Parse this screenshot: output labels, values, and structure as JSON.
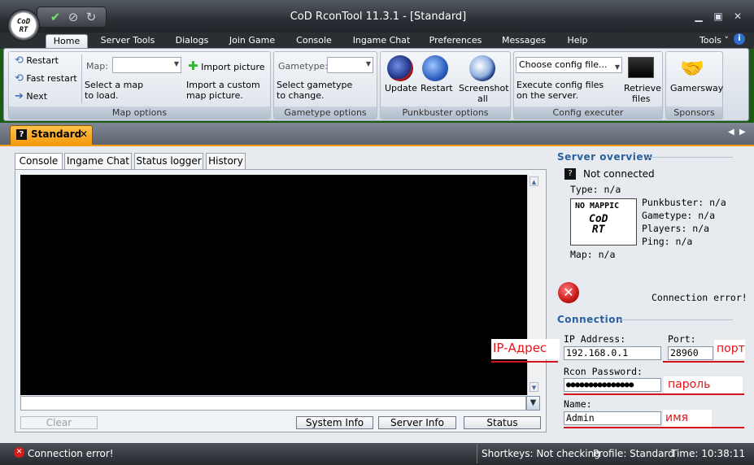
{
  "window": {
    "title": "CoD RconTool 11.3.1 - [Standard]",
    "logo_text": "CoD\nRT"
  },
  "ribbon_tabs": [
    "Home",
    "Server Tools",
    "Dialogs",
    "Join Game",
    "Console",
    "Ingame Chat",
    "Preferences",
    "Messages",
    "Help"
  ],
  "tools_menu": "Tools",
  "map_options": {
    "restart": "Restart",
    "fast_restart": "Fast restart",
    "next": "Next",
    "map_label": "Map:",
    "select_hint_1": "Select a map",
    "select_hint_2": "to load.",
    "import_picture": "Import picture",
    "import_hint_1": "Import a custom",
    "import_hint_2": "map picture.",
    "group_label": "Map options"
  },
  "gametype_options": {
    "label": "Gametype:",
    "hint_1": "Select gametype",
    "hint_2": "to change.",
    "group_label": "Gametype options"
  },
  "punkbuster_options": {
    "update": "Update",
    "restart": "Restart",
    "screenshot_1": "Screenshot",
    "screenshot_2": "all",
    "group_label": "Punkbuster options"
  },
  "config_executer": {
    "placeholder": "Choose config file...",
    "hint_1": "Execute config files",
    "hint_2": "on the server.",
    "retrieve_1": "Retrieve",
    "retrieve_2": "files",
    "group_label": "Config executer"
  },
  "sponsors": {
    "gamersway": "Gamersway",
    "group_label": "Sponsors"
  },
  "document_tab": {
    "label": "Standard",
    "close": "✕"
  },
  "console_tabs": [
    "Console",
    "Ingame Chat",
    "Status logger",
    "History"
  ],
  "console_buttons": {
    "clear": "Clear",
    "system_info": "System Info",
    "server_info": "Server Info",
    "status": "Status"
  },
  "server_overview": {
    "heading": "Server overview",
    "status": "Not connected",
    "type": "Type: n/a",
    "map_thumb_top": "NO MAPPIC",
    "map_thumb_logo": "CoD\nRT",
    "punkbuster": "Punkbuster: n/a",
    "gametype": "Gametype: n/a",
    "players": "Players: n/a",
    "ping": "Ping: n/a",
    "map": "Map: n/a",
    "error": "Connection error!"
  },
  "connection": {
    "heading": "Connection",
    "ip_label": "IP Address:",
    "ip_value": "192.168.0.1",
    "port_label": "Port:",
    "port_value": "28960",
    "password_label": "Rcon Password:",
    "password_value": "●●●●●●●●●●●●●●●",
    "name_label": "Name:",
    "name_value": "Admin"
  },
  "annotations": {
    "ip": "IP-Адрес",
    "port": "порт",
    "password": "пароль",
    "name": "имя"
  },
  "statusbar": {
    "error": "Connection error!",
    "shortkeys": "Shortkeys: Not checking",
    "profile": "Profile: Standard",
    "time": "Time: 10:38:11"
  },
  "colors": {
    "accent_orange": "#f39a0e",
    "heading_blue": "#2a5f9e",
    "annotation_red": "#e8141a"
  }
}
